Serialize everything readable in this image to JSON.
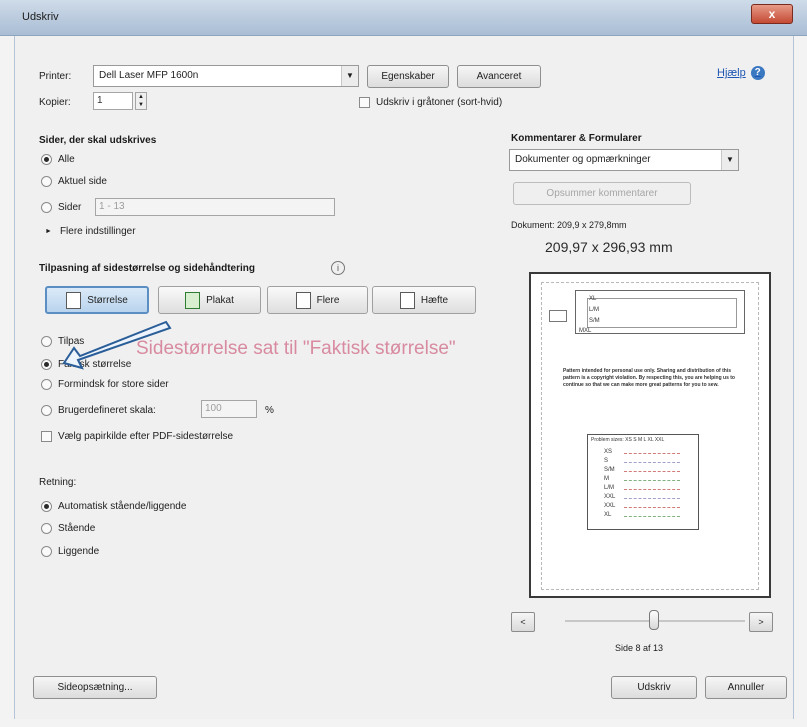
{
  "window": {
    "title": "Udskriv",
    "close": "x"
  },
  "printer": {
    "label": "Printer:",
    "value": "Dell Laser MFP 1600n",
    "properties_button": "Egenskaber",
    "advanced_button": "Avanceret",
    "help_link": "Hjælp"
  },
  "copies": {
    "label": "Kopier:",
    "value": "1",
    "grayscale_label": "Udskriv i gråtoner (sort-hvid)"
  },
  "pages": {
    "heading": "Sider, der skal udskrives",
    "all": "Alle",
    "current": "Aktuel side",
    "pages_label": "Sider",
    "pages_value": "1 - 13",
    "more_options": "Flere indstillinger"
  },
  "sizing": {
    "heading": "Tilpasning af sidestørrelse og sidehåndtering",
    "info_icon": "i",
    "size_button": "Størrelse",
    "poster_button": "Plakat",
    "multiple_button": "Flere",
    "booklet_button": "Hæfte",
    "fit": "Tilpas",
    "actual": "Faktisk størrelse",
    "shrink": "Formindsk for store sider",
    "custom": "Brugerdefineret skala:",
    "custom_value": "100",
    "percent": "%",
    "choose_paper": "Vælg papirkilde efter PDF-sidestørrelse"
  },
  "orientation": {
    "heading": "Retning:",
    "auto": "Automatisk stående/liggende",
    "portrait": "Stående",
    "landscape": "Liggende"
  },
  "comments": {
    "heading": "Kommentarer & Formularer",
    "select_value": "Dokumenter og opmærkninger",
    "summarize_button": "Opsummer kommentarer",
    "document_size": "Dokument: 209,9 x 279,8mm",
    "preview_size": "209,97 x 296,93 mm"
  },
  "preview": {
    "paragraph": "Pattern intended for personal use only. Sharing and distribution of this pattern is a copyright violation. By respecting this, you are helping us to continue so that we can make more great patterns for you to sew.",
    "table_header": "Problem sizes: XS  S  M  L  XL  XXL",
    "sizes": [
      "XS",
      "S",
      "S/M",
      "M",
      "L/M",
      "XXL",
      "XXL",
      "XL"
    ],
    "side_labels": [
      "XL",
      "L/M",
      "S/M",
      "MXL"
    ]
  },
  "nav": {
    "prev": "<",
    "next": ">",
    "page_status": "Side 8 af 13"
  },
  "footer": {
    "page_setup_button": "Sideopsætning...",
    "print_button": "Udskriv",
    "cancel_button": "Annuller"
  },
  "annotation": {
    "text": "Sidestørrelse sat til \"Faktisk størrelse\""
  },
  "colors": {
    "accent": "#5b8fc4",
    "annotation_text": "#d88aa0",
    "arrow": "#2a5e98"
  }
}
